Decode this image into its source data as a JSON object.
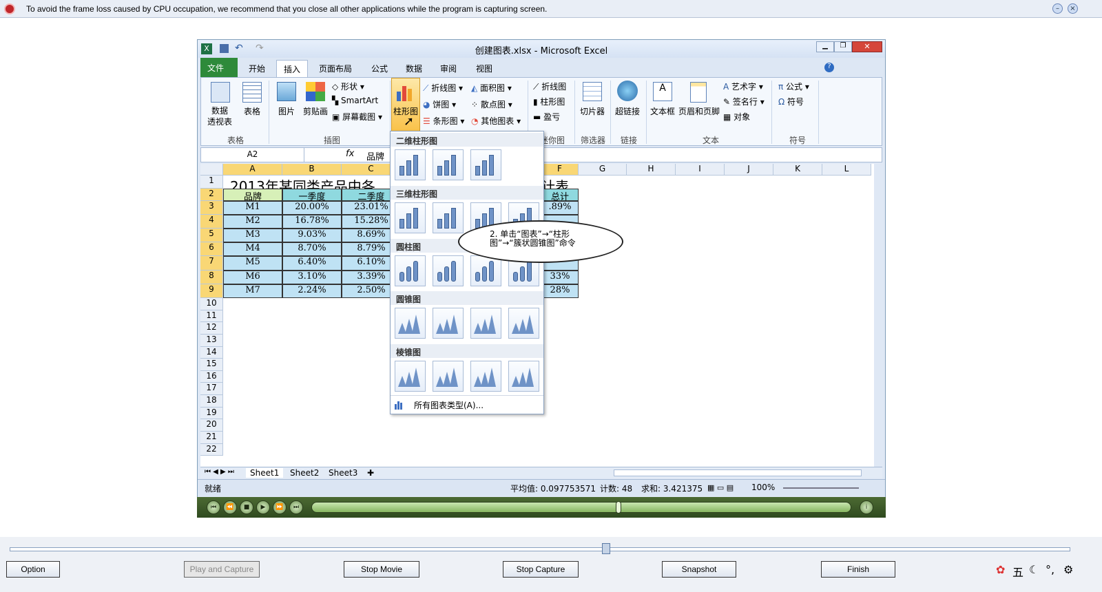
{
  "topbar": {
    "message": "To avoid the frame loss caused by CPU occupation, we recommend that you close all other applications while the program is capturing screen."
  },
  "excel": {
    "title": "创建图表.xlsx - Microsoft Excel",
    "tabs": [
      "文件",
      "开始",
      "插入",
      "页面布局",
      "公式",
      "数据",
      "审阅",
      "视图"
    ],
    "active_tab": "插入",
    "ribbon": {
      "pivot": "数据\n透视表",
      "table": "表格",
      "picture": "图片",
      "clipart": "剪贴画",
      "shapes": "形状",
      "smartart": "SmartArt",
      "screenshot": "屏幕截图",
      "column": "柱形图",
      "line": "折线图",
      "pie": "饼图",
      "bar": "条形图",
      "area": "面积图",
      "scatter": "散点图",
      "other": "其他图表",
      "spark_line": "折线图",
      "spark_col": "柱形图",
      "spark_wl": "盈亏",
      "slicer": "切片器",
      "hyperlink": "超链接",
      "textbox": "文本框",
      "header": "页眉和页脚",
      "wordart": "艺术字",
      "signature": "签名行",
      "object": "对象",
      "formula": "公式",
      "symbol": "符号",
      "groups": [
        "表格",
        "插图",
        "迷你图",
        "筛选器",
        "链接",
        "文本",
        "符号"
      ]
    },
    "namebox": "A2",
    "formula_value": "品牌",
    "columns": [
      "A",
      "B",
      "C",
      "F",
      "G",
      "H",
      "I",
      "J",
      "K",
      "L"
    ],
    "rows": [
      "1",
      "2",
      "3",
      "4",
      "5",
      "6",
      "7",
      "8",
      "9",
      "10",
      "11",
      "12",
      "13",
      "14",
      "15",
      "16",
      "17",
      "18",
      "19",
      "20",
      "21",
      "22"
    ],
    "sheet_title_left": "2013年某同类产品中各",
    "sheet_title_right": "计表",
    "headers": [
      "品牌",
      "一季度",
      "二季度"
    ],
    "header_right": "总计",
    "table": [
      [
        "M1",
        "20.00%",
        "23.01%"
      ],
      [
        "M2",
        "16.78%",
        "15.28%"
      ],
      [
        "M3",
        "9.03%",
        "8.69%"
      ],
      [
        "M4",
        "8.70%",
        "8.79%"
      ],
      [
        "M5",
        "6.40%",
        "6.10%"
      ],
      [
        "M6",
        "3.10%",
        "3.39%"
      ],
      [
        "M7",
        "2.24%",
        "2.50%"
      ]
    ],
    "right_col": [
      ".89%",
      "",
      "",
      "",
      "",
      "33%",
      "28%"
    ],
    "sheets": [
      "Sheet1",
      "Sheet2",
      "Sheet3"
    ],
    "status": {
      "ready": "就绪",
      "average": "平均值: 0.097753571",
      "count": "计数: 48",
      "sum": "求和: 3.421375",
      "zoom": "100%"
    }
  },
  "dropdown": {
    "sections": [
      "二维柱形图",
      "三维柱形图",
      "圆柱图",
      "圆锥图",
      "棱锥图"
    ],
    "all_types": "所有图表类型(A)..."
  },
  "callout": "2. 单击“图表”→“柱形图”→“簇状圆锥图”命令",
  "bottom": {
    "option": "Option",
    "play": "Play and Capture",
    "stop_movie": "Stop Movie",
    "stop_capture": "Stop Capture",
    "snapshot": "Snapshot",
    "finish": "Finish"
  }
}
